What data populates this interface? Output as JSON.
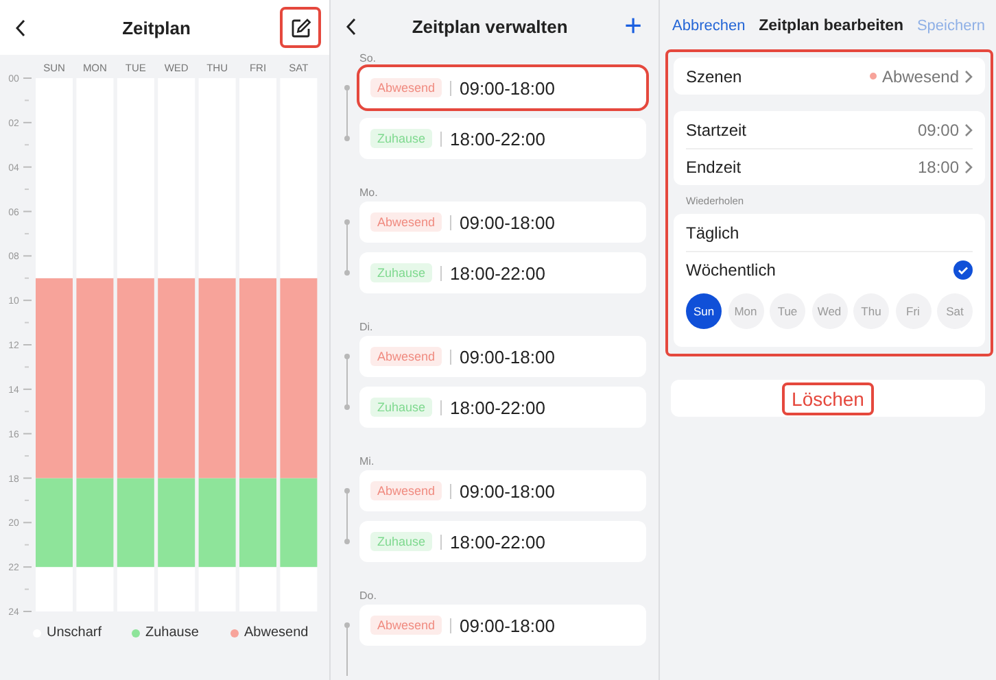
{
  "overview": {
    "title": "Zeitplan",
    "edit_button": {
      "highlighted": true
    },
    "chart_data": {
      "type": "bar",
      "stacked": true,
      "orientation": "vertical",
      "categories": [
        "SUN",
        "MON",
        "TUE",
        "WED",
        "THU",
        "FRI",
        "SAT"
      ],
      "ylim": [
        24,
        0
      ],
      "yticks": [
        {
          "value": 0,
          "label": "00"
        },
        {
          "value": 2,
          "label": "02"
        },
        {
          "value": 4,
          "label": "04"
        },
        {
          "value": 6,
          "label": "06"
        },
        {
          "value": 8,
          "label": "08"
        },
        {
          "value": 10,
          "label": "10"
        },
        {
          "value": 12,
          "label": "12"
        },
        {
          "value": 14,
          "label": "14"
        },
        {
          "value": 16,
          "label": "16"
        },
        {
          "value": 18,
          "label": "18"
        },
        {
          "value": 20,
          "label": "20"
        },
        {
          "value": 22,
          "label": "22"
        },
        {
          "value": 24,
          "label": "24"
        }
      ],
      "series": [
        {
          "name": "Unscharf",
          "color": "#ffffff",
          "values": [
            2,
            2,
            2,
            2,
            2,
            2,
            2
          ]
        },
        {
          "name": "Zuhause",
          "color": "#8ee49a",
          "values": [
            4,
            4,
            4,
            4,
            4,
            4,
            4
          ]
        },
        {
          "name": "Abwesend",
          "color": "#f7a39a",
          "values": [
            9,
            9,
            9,
            9,
            9,
            9,
            9
          ]
        },
        {
          "color": "#ffffff",
          "values": [
            9,
            9,
            9,
            9,
            9,
            9,
            9
          ]
        }
      ]
    }
  },
  "manage": {
    "title": "Zeitplan verwalten",
    "add_button": "+",
    "days": [
      {
        "label": "So.",
        "entries": [
          {
            "kind": "away",
            "scene": "Abwesend",
            "time": "09:00-18:00",
            "highlighted": true
          },
          {
            "kind": "home",
            "scene": "Zuhause",
            "time": "18:00-22:00",
            "highlighted": false
          }
        ]
      },
      {
        "label": "Mo.",
        "entries": [
          {
            "kind": "away",
            "scene": "Abwesend",
            "time": "09:00-18:00",
            "highlighted": false
          },
          {
            "kind": "home",
            "scene": "Zuhause",
            "time": "18:00-22:00",
            "highlighted": false
          }
        ]
      },
      {
        "label": "Di.",
        "entries": [
          {
            "kind": "away",
            "scene": "Abwesend",
            "time": "09:00-18:00",
            "highlighted": false
          },
          {
            "kind": "home",
            "scene": "Zuhause",
            "time": "18:00-22:00",
            "highlighted": false
          }
        ]
      },
      {
        "label": "Mi.",
        "entries": [
          {
            "kind": "away",
            "scene": "Abwesend",
            "time": "09:00-18:00",
            "highlighted": false
          },
          {
            "kind": "home",
            "scene": "Zuhause",
            "time": "18:00-22:00",
            "highlighted": false
          }
        ]
      },
      {
        "label": "Do.",
        "entries": [
          {
            "kind": "away",
            "scene": "Abwesend",
            "time": "09:00-18:00",
            "highlighted": false
          }
        ]
      }
    ]
  },
  "editor": {
    "cancel": "Abbrechen",
    "title": "Zeitplan bearbeiten",
    "save": {
      "label": "Speichern",
      "disabled": true
    },
    "form": {
      "highlighted": true,
      "scene": {
        "label": "Szenen",
        "kind": "away",
        "value": "Abwesend"
      },
      "times": [
        {
          "label": "Startzeit",
          "value": "09:00"
        },
        {
          "label": "Endzeit",
          "value": "18:00"
        }
      ],
      "repeat_label": "Wiederholen",
      "repeat_options": [
        {
          "label": "Täglich",
          "selected": false
        },
        {
          "label": "Wöchentlich",
          "selected": true
        }
      ],
      "weekdays": [
        {
          "label": "Sun",
          "selected": true
        },
        {
          "label": "Mon",
          "selected": false
        },
        {
          "label": "Tue",
          "selected": false
        },
        {
          "label": "Wed",
          "selected": false
        },
        {
          "label": "Thu",
          "selected": false
        },
        {
          "label": "Fri",
          "selected": false
        },
        {
          "label": "Sat",
          "selected": false
        }
      ]
    },
    "delete": {
      "label": "Löschen",
      "highlighted": true
    }
  }
}
